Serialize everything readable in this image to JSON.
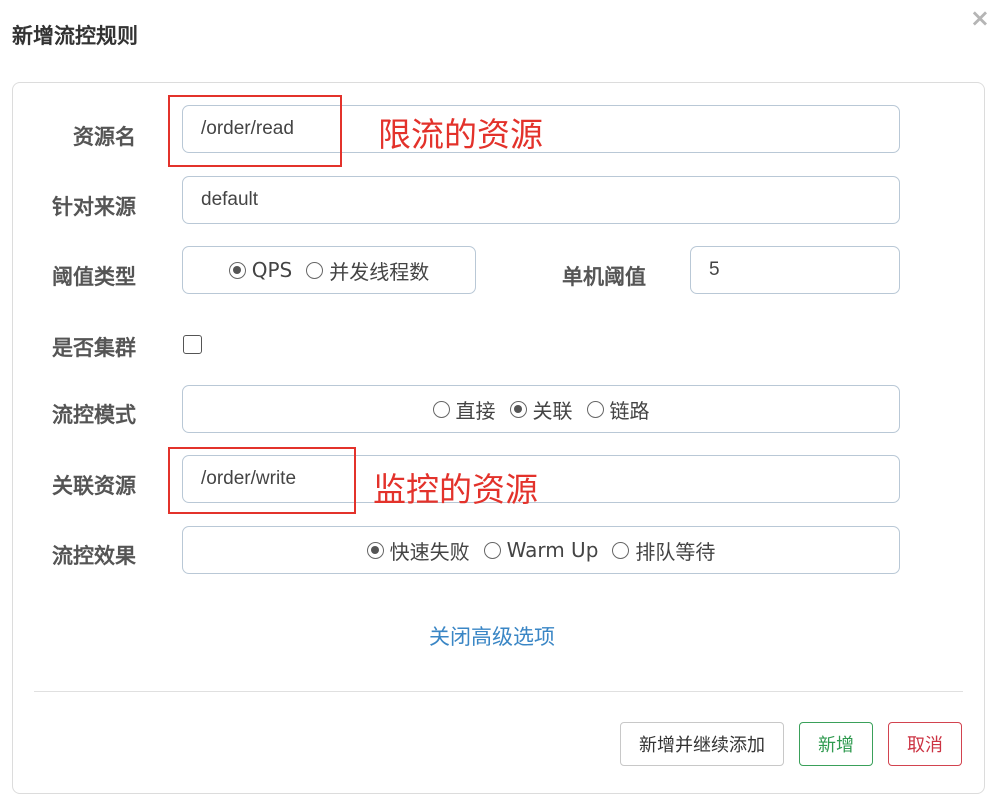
{
  "dialog": {
    "title": "新增流控规则",
    "close_label": "×"
  },
  "form": {
    "resource_name": {
      "label": "资源名",
      "value": "/order/read"
    },
    "limit_app": {
      "label": "针对来源",
      "value": "default"
    },
    "grade": {
      "label": "阈值类型",
      "options": [
        "QPS",
        "并发线程数"
      ],
      "selected": "QPS"
    },
    "count": {
      "label": "单机阈值",
      "value": "5"
    },
    "cluster": {
      "label": "是否集群",
      "checked": false
    },
    "strategy": {
      "label": "流控模式",
      "options": [
        "直接",
        "关联",
        "链路"
      ],
      "selected": "关联"
    },
    "ref_resource": {
      "label": "关联资源",
      "value": "/order/write"
    },
    "control_behavior": {
      "label": "流控效果",
      "options": [
        "快速失败",
        "Warm Up",
        "排队等待"
      ],
      "selected": "快速失败"
    }
  },
  "toggle_advanced_label": "关闭高级选项",
  "annotations": {
    "resource_note": "限流的资源",
    "ref_note": "监控的资源",
    "color": "#e3322b"
  },
  "buttons": {
    "add_continue": "新增并继续添加",
    "add": "新增",
    "cancel": "取消"
  }
}
